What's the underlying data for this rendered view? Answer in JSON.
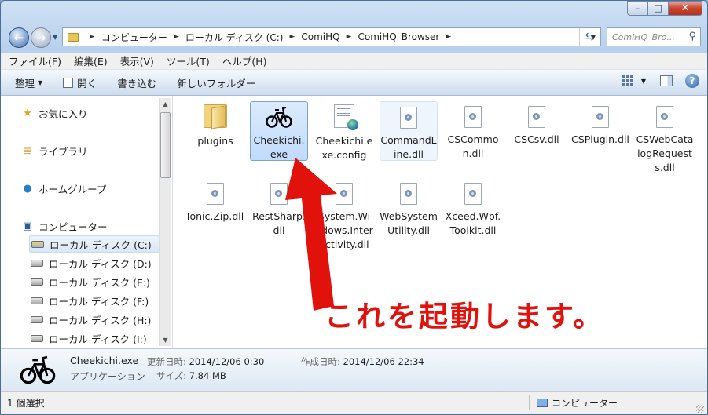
{
  "window": {
    "caption": {
      "minimize": "–",
      "maximize": "□",
      "close": "✕"
    }
  },
  "address": {
    "crumbs": [
      "コンピューター",
      "ローカル ディスク (C:)",
      "ComiHQ",
      "ComiHQ_Browser"
    ],
    "search_placeholder": "ComiHQ_Bro..."
  },
  "menu": [
    "ファイル(F)",
    "編集(E)",
    "表示(V)",
    "ツール(T)",
    "ヘルプ(H)"
  ],
  "toolbar": {
    "organize": "整理",
    "open": "開く",
    "burn": "書き込む",
    "new_folder": "新しいフォルダー"
  },
  "nav": {
    "favorites": "お気に入り",
    "libraries": "ライブラリ",
    "homegroup": "ホームグループ",
    "computer": "コンピューター",
    "drives": [
      "ローカル ディスク (C:)",
      "ローカル ディスク (D:)",
      "ローカル ディスク (E:)",
      "ローカル ディスク (F:)",
      "ローカル ディスク (H:)",
      "ローカル ディスク (I:)"
    ]
  },
  "files": [
    {
      "name": "plugins",
      "icon": "folder-icon"
    },
    {
      "name": "Cheekichi.exe",
      "icon": "bicycle-icon"
    },
    {
      "name": "Cheekichi.exe.config",
      "icon": "config-icon"
    },
    {
      "name": "CommandLine.dll",
      "icon": "dll-icon"
    },
    {
      "name": "CSCommon.dll",
      "icon": "dll-icon"
    },
    {
      "name": "CSCsv.dll",
      "icon": "dll-icon"
    },
    {
      "name": "CSPlugin.dll",
      "icon": "dll-icon"
    },
    {
      "name": "CSWebCatalogRequests.dll",
      "icon": "dll-icon"
    },
    {
      "name": "Ionic.Zip.dll",
      "icon": "dll-icon"
    },
    {
      "name": "RestSharp.dll",
      "icon": "dll-icon"
    },
    {
      "name": "System.Windows.Interactivity.dll",
      "icon": "dll-icon"
    },
    {
      "name": "WebSystemUtility.dll",
      "icon": "dll-icon"
    },
    {
      "name": "Xceed.Wpf.Toolkit.dll",
      "icon": "dll-icon"
    }
  ],
  "annotation": "これを起動します。",
  "annotation_color": "#e1110c",
  "details": {
    "name": "Cheekichi.exe",
    "type": "アプリケーション",
    "modified_label": "更新日時:",
    "modified": "2014/12/06 0:30",
    "size_label": "サイズ:",
    "size": "7.84 MB",
    "created_label": "作成日時:",
    "created": "2014/12/06 22:34"
  },
  "status": {
    "selected": "1 個選択",
    "location": "コンピューター"
  }
}
